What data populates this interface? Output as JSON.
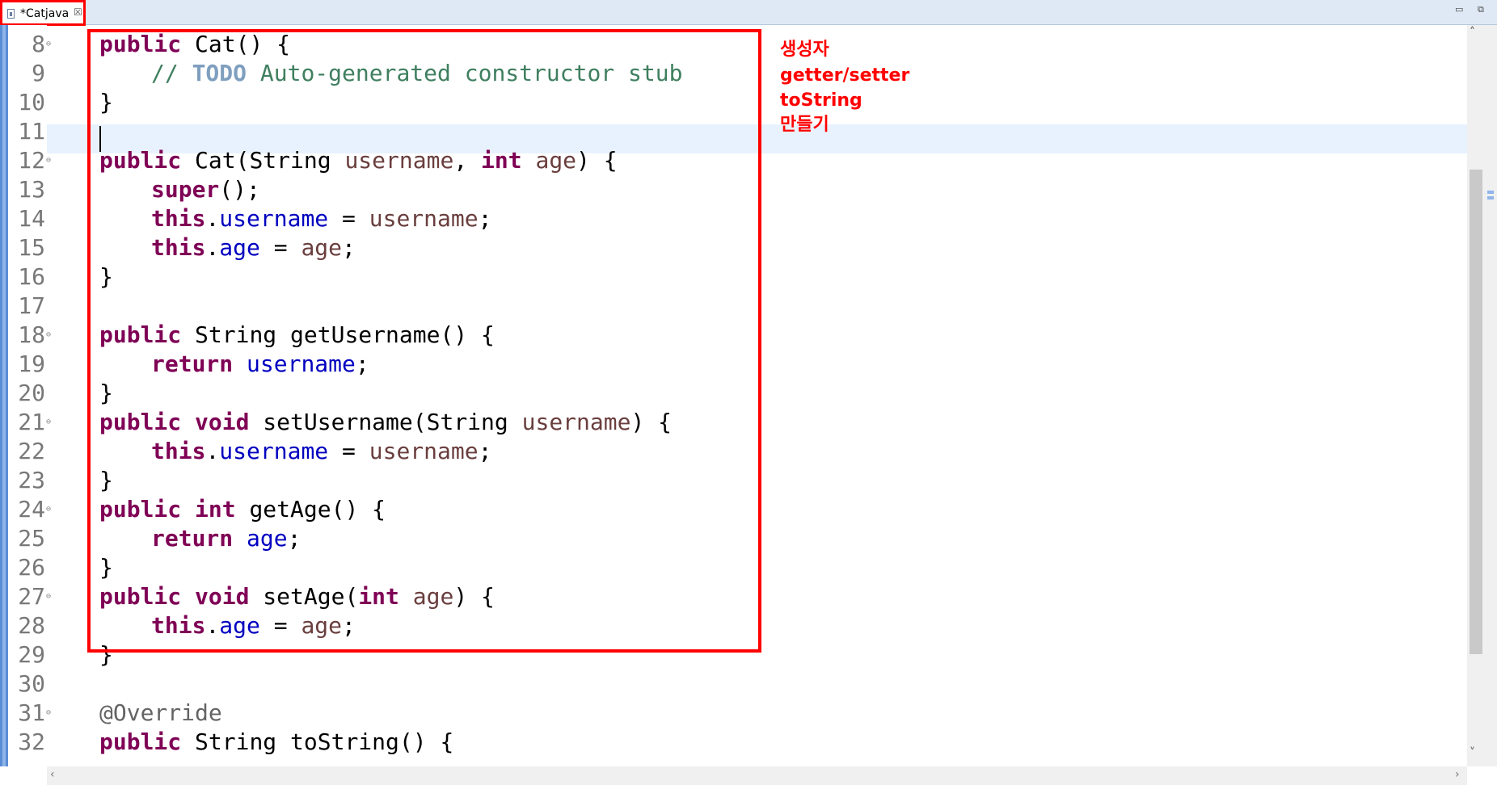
{
  "tab": {
    "label": "*Catjava",
    "close": "☒"
  },
  "window": {
    "minimize": "▭",
    "maximize": "⧉"
  },
  "line_numbers": [
    "8",
    "9",
    "10",
    "11",
    "12",
    "13",
    "14",
    "15",
    "16",
    "17",
    "18",
    "19",
    "20",
    "21",
    "22",
    "23",
    "24",
    "25",
    "26",
    "27",
    "28",
    "29",
    "30",
    "31",
    "32"
  ],
  "annotation_note": [
    "생성자",
    "getter/setter",
    "toString",
    "만들기"
  ],
  "code": {
    "l8": {
      "kw": "public",
      "rest": " Cat() {"
    },
    "l9": {
      "comment_start": "// ",
      "todo": "TODO",
      "comment_rest": " Auto-generated constructor stub"
    },
    "l10": {
      "text": "}"
    },
    "l12": {
      "kw1": "public",
      "t1": " Cat(String ",
      "p1": "username",
      "t2": ", ",
      "kw2": "int",
      "t3": " ",
      "p2": "age",
      "t4": ") {"
    },
    "l13": {
      "kw": "super",
      "rest": "();"
    },
    "l14": {
      "kw": "this",
      "dot": ".",
      "fld": "username",
      "eq": " = ",
      "par": "username",
      "end": ";"
    },
    "l15": {
      "kw": "this",
      "dot": ".",
      "fld": "age",
      "eq": " = ",
      "par": "age",
      "end": ";"
    },
    "l16": {
      "text": "}"
    },
    "l18": {
      "kw": "public",
      "rest": " String getUsername() {"
    },
    "l19": {
      "kw": "return",
      "sp": " ",
      "fld": "username",
      "end": ";"
    },
    "l20": {
      "text": "}"
    },
    "l21": {
      "kw1": "public",
      "sp": " ",
      "kw2": "void",
      "t1": " setUsername(String ",
      "par": "username",
      "t2": ") {"
    },
    "l22": {
      "kw": "this",
      "dot": ".",
      "fld": "username",
      "eq": " = ",
      "par": "username",
      "end": ";"
    },
    "l23": {
      "text": "}"
    },
    "l24": {
      "kw1": "public",
      "sp": " ",
      "kw2": "int",
      "rest": " getAge() {"
    },
    "l25": {
      "kw": "return",
      "sp": " ",
      "fld": "age",
      "end": ";"
    },
    "l26": {
      "text": "}"
    },
    "l27": {
      "kw1": "public",
      "sp": " ",
      "kw2": "void",
      "t1": " setAge(",
      "kw3": "int",
      "t2": " ",
      "par": "age",
      "t3": ") {"
    },
    "l28": {
      "kw": "this",
      "dot": ".",
      "fld": "age",
      "eq": " = ",
      "par": "age",
      "end": ";"
    },
    "l29": {
      "text": "}"
    },
    "l31": {
      "ann": "@Override"
    },
    "l32": {
      "kw": "public",
      "rest": " String toString() {"
    }
  },
  "scroll": {
    "up": "˄",
    "down": "˅",
    "left": "‹",
    "right": "›"
  }
}
